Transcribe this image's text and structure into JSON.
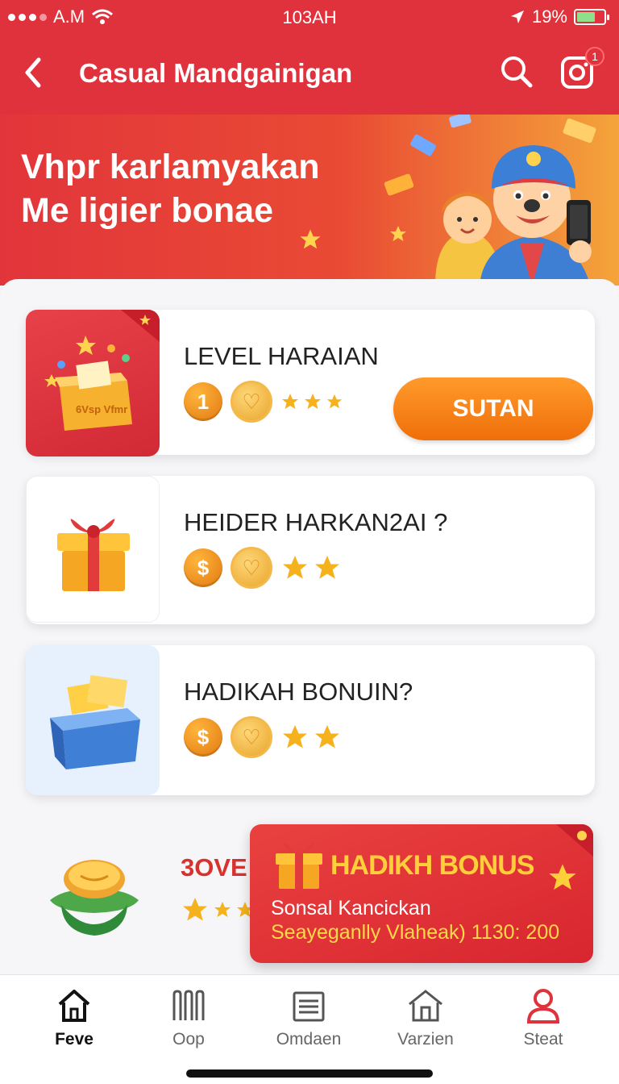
{
  "status_bar": {
    "carrier": "A.M",
    "time": "103AH",
    "battery_pct": "19%"
  },
  "header": {
    "title": "Casual Mandgainigan",
    "notification_count": "1"
  },
  "banner": {
    "line1": "Vhpr karlamyakan",
    "line2": "Me ligier bonae"
  },
  "cards": [
    {
      "title": "LEVEL HARAIAN",
      "coin_label": "1",
      "thumb_text": "6Vsp Vfmr",
      "button_label": "SUTAN"
    },
    {
      "title": "HEIDER HARKAN2AI ?",
      "coin_label": "$"
    },
    {
      "title": "HADIKAH BONUIN?",
      "coin_label": "$"
    }
  ],
  "partial_card": {
    "title": "3OVE"
  },
  "bonus_toast": {
    "title": "HADIKH BONUS",
    "line1": "Sonsal Kancickan",
    "line2": "Seayeganlly Vlaheak) 1130: 200"
  },
  "tabs": [
    {
      "label": "Feve",
      "icon": "home-icon",
      "active": true
    },
    {
      "label": "Oop",
      "icon": "columns-icon",
      "active": false
    },
    {
      "label": "Omdaen",
      "icon": "document-icon",
      "active": false
    },
    {
      "label": "Varzien",
      "icon": "store-icon",
      "active": false
    },
    {
      "label": "Steat",
      "icon": "profile-icon",
      "active": false
    }
  ],
  "colors": {
    "primary": "#e0323c",
    "accent": "#ef6f0a",
    "gold": "#f5b21c"
  }
}
